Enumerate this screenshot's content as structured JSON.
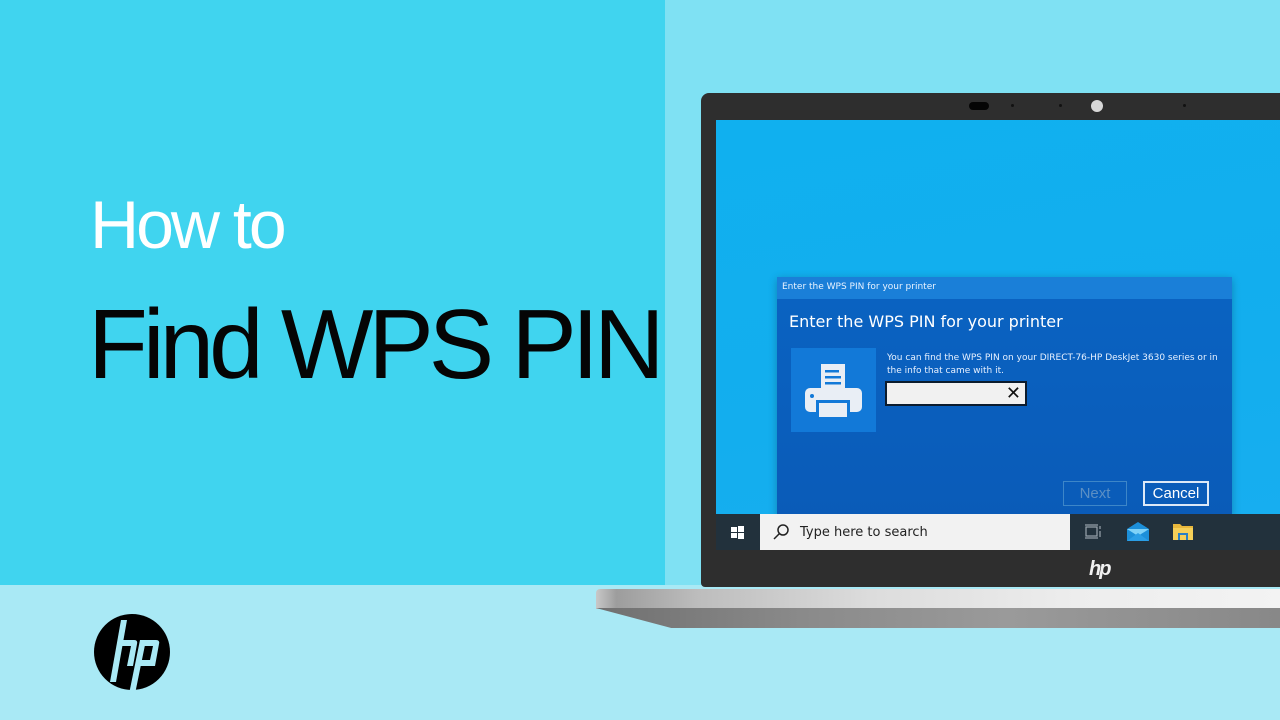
{
  "title": {
    "line1": "How to",
    "line2": "Find WPS PIN"
  },
  "brand": {
    "logo": "hp-logo",
    "bezel_logo": "hp"
  },
  "colors": {
    "left_panel": "#40d4ef",
    "right_panel": "#7fe1f3",
    "bottom_band": "#a9e9f5",
    "screen": "#10b0ef",
    "dialog": "#0a63c2",
    "taskbar": "#22313c"
  },
  "dialog": {
    "titlebar": "Enter the WPS PIN for your printer",
    "heading": "Enter the WPS PIN for your printer",
    "icon": "printer-icon",
    "description": "You can find the WPS PIN on your DIRECT-76-HP DeskJet 3630 series or in the info that came with it.",
    "pin_value": "",
    "pin_placeholder": "",
    "clear_symbol": "✕",
    "next_label": "Next",
    "cancel_label": "Cancel"
  },
  "taskbar": {
    "start_icon": "windows-icon",
    "search_placeholder": "Type here to search",
    "pinned": [
      "task-view-icon",
      "mail-icon",
      "file-explorer-icon"
    ]
  }
}
